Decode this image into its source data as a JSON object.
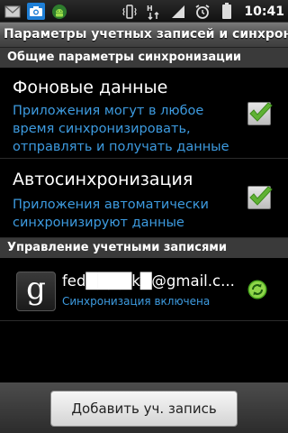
{
  "status_bar": {
    "icons": [
      "mail-icon",
      "camera-icon",
      "android-icon",
      "vibrate-icon",
      "network-icon",
      "signal-icon",
      "alarm-icon",
      "battery-icon"
    ],
    "time": "10:41"
  },
  "title": "Параметры учетных записей и синхрон...",
  "general_section": {
    "header": "Общие параметры синхронизации",
    "settings": [
      {
        "title": "Фоновые данные",
        "description": "Приложения могут в любое время синхронизировать, отправлять и получать данные",
        "checked": true
      },
      {
        "title": "Автосинхронизация",
        "description": "Приложения автоматически синхронизируют данные",
        "checked": true
      }
    ]
  },
  "accounts_section": {
    "header": "Управление учетными записями",
    "accounts": [
      {
        "icon": "google-icon",
        "email": "fed████k█@gmail.c...",
        "status": "Синхронизация включена",
        "sync_icon": "sync-icon"
      }
    ]
  },
  "bottom": {
    "add_account_label": "Добавить уч. запись"
  },
  "colors": {
    "accent_blue": "#3d9be0",
    "check_green": "#5fb233",
    "header_bg": "#3a3a3a"
  }
}
